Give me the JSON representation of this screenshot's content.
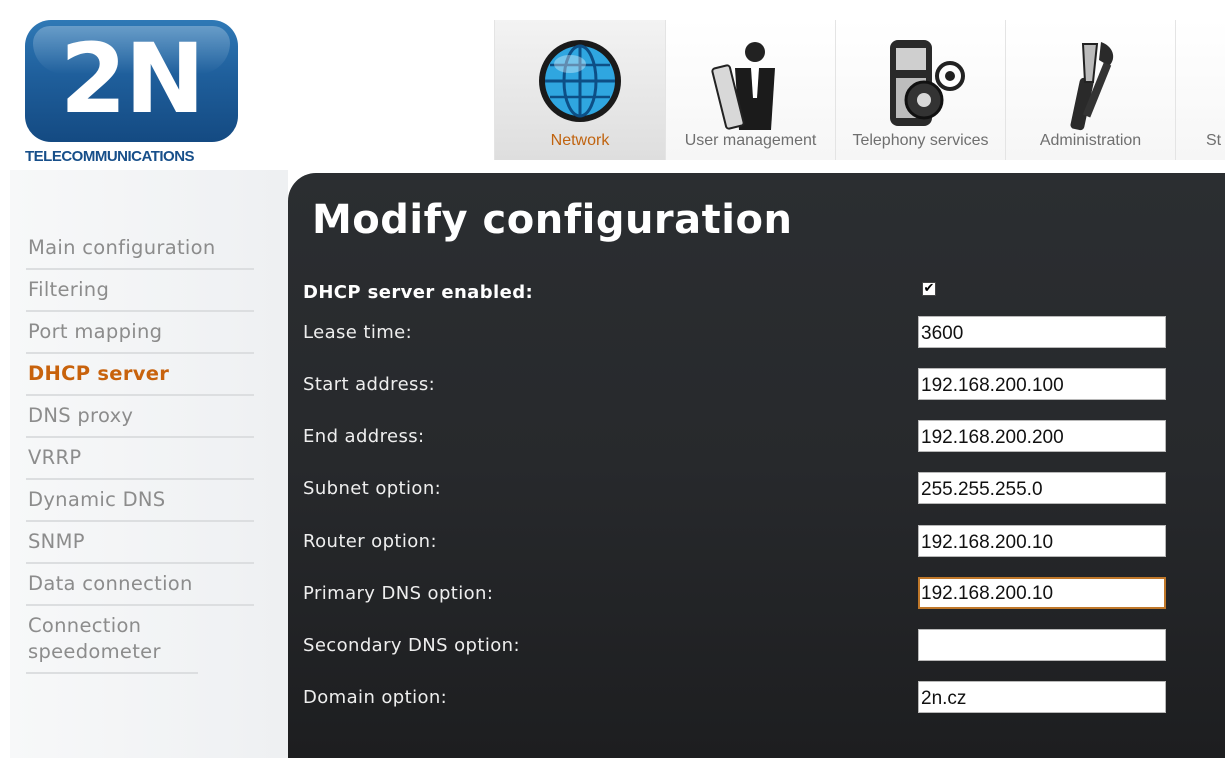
{
  "logo": {
    "mark": "2N",
    "subtitle": "TELECOMMUNICATIONS"
  },
  "topnav": {
    "items": [
      {
        "label": "Network",
        "icon": "globe-icon",
        "active": true
      },
      {
        "label": "User management",
        "icon": "user-icon",
        "active": false
      },
      {
        "label": "Telephony services",
        "icon": "phone-gears-icon",
        "active": false
      },
      {
        "label": "Administration",
        "icon": "tools-icon",
        "active": false
      },
      {
        "label": "St",
        "icon": "status-icon",
        "active": false
      }
    ]
  },
  "sidebar": {
    "items": [
      {
        "label": "Main configuration",
        "active": false
      },
      {
        "label": "Filtering",
        "active": false
      },
      {
        "label": "Port mapping",
        "active": false
      },
      {
        "label": "DHCP server",
        "active": true
      },
      {
        "label": "DNS proxy",
        "active": false
      },
      {
        "label": "VRRP",
        "active": false
      },
      {
        "label": "Dynamic DNS",
        "active": false
      },
      {
        "label": "SNMP",
        "active": false
      },
      {
        "label": "Data connection",
        "active": false
      },
      {
        "label": "Connection speedometer",
        "active": false
      }
    ]
  },
  "main": {
    "title": "Modify configuration",
    "dhcp_enabled": {
      "label": "DHCP server enabled:",
      "checked": true,
      "mark": "✔"
    },
    "fields": [
      {
        "label": "Lease time:",
        "value": "3600"
      },
      {
        "label": "Start address:",
        "value": "192.168.200.100"
      },
      {
        "label": "End address:",
        "value": "192.168.200.200"
      },
      {
        "label": "Subnet option:",
        "value": "255.255.255.0"
      },
      {
        "label": "Router option:",
        "value": "192.168.200.10"
      },
      {
        "label": "Primary DNS option:",
        "value": "192.168.200.10",
        "focused": true
      },
      {
        "label": "Secondary DNS option:",
        "value": ""
      },
      {
        "label": "Domain option:",
        "value": "2n.cz"
      }
    ]
  },
  "colors": {
    "accent": "#c8620c",
    "panel": "#2b2e31",
    "brand_blue": "#1f5f9c"
  }
}
